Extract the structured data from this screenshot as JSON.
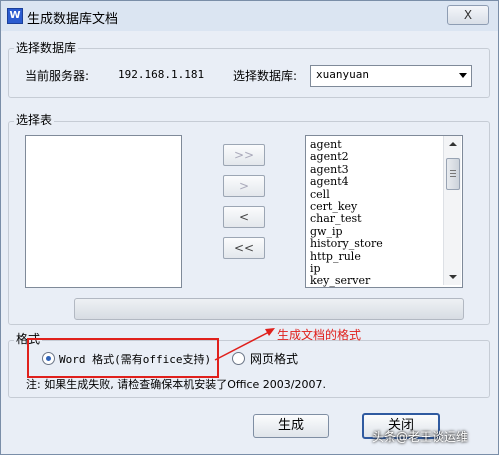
{
  "window": {
    "app_icon": "W",
    "title": "生成数据库文档",
    "close_glyph": "X"
  },
  "select_db": {
    "group_label": "选择数据库",
    "server_label": "当前服务器:",
    "server_value": "192.168.1.181",
    "db_label": "选择数据库:",
    "db_value": "xuanyuan"
  },
  "select_tables": {
    "group_label": "选择表",
    "left_list": [],
    "right_list": [
      "agent",
      "agent2",
      "agent3",
      "agent4",
      "cell",
      "cert_key",
      "char_test",
      "gw_ip",
      "history_store",
      "http_rule",
      "ip",
      "key_server"
    ],
    "buttons": {
      "add_all": ">>",
      "add": ">",
      "remove": "<",
      "remove_all": "<<"
    }
  },
  "format": {
    "group_label": "格式",
    "option_word": "Word 格式(需有office支持)",
    "option_web": "网页格式",
    "selected": "word",
    "note": "注: 如果生成失败, 请检查确保本机安装了Office 2003/2007."
  },
  "annotation": {
    "text": "生成文档的格式",
    "color": "#e0201c"
  },
  "footer": {
    "generate_label": "生成",
    "close_label": "关闭"
  },
  "watermark": "头条@老王谈运维"
}
